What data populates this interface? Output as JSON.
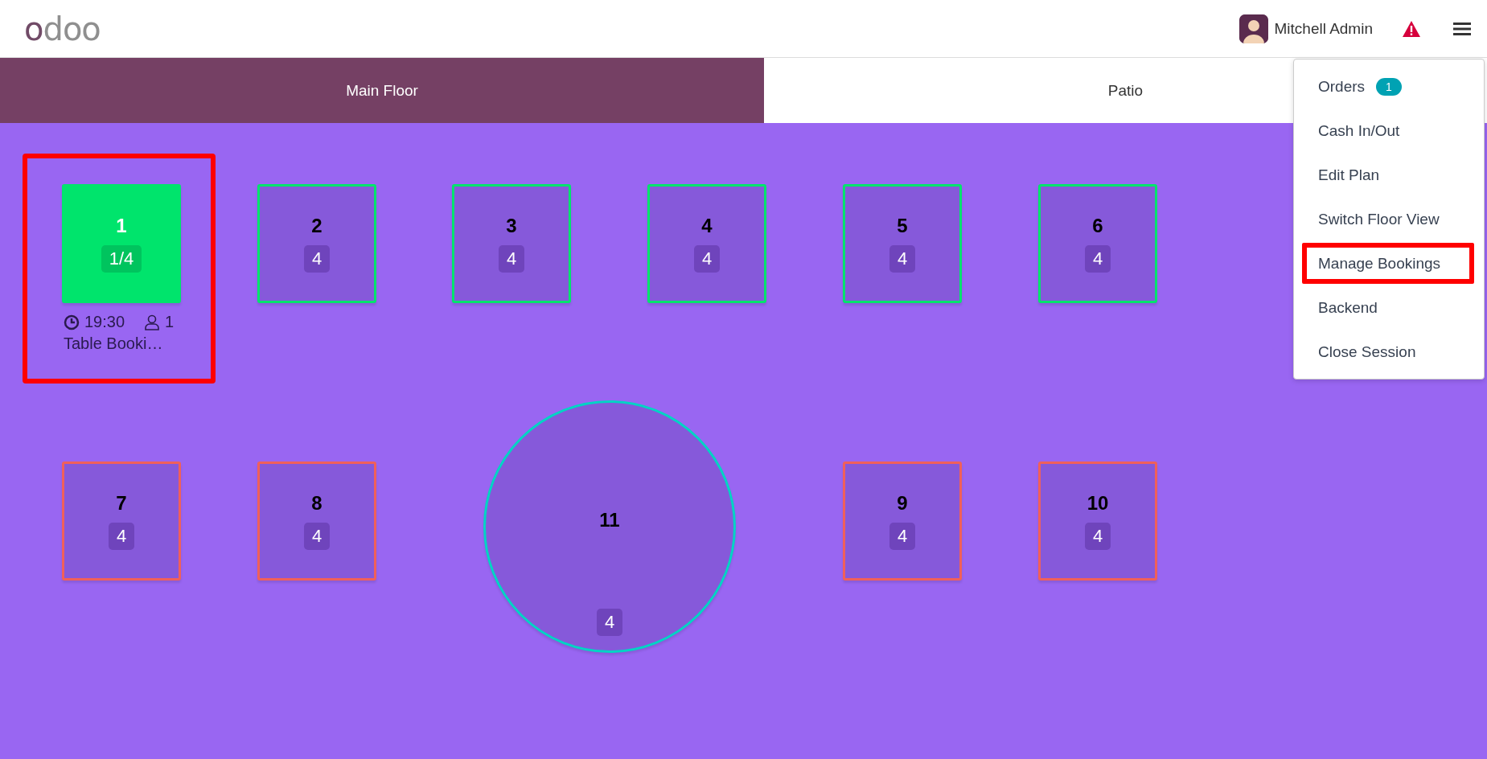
{
  "header": {
    "logo": "odoo",
    "user": "Mitchell Admin"
  },
  "floors": [
    {
      "label": "Main Floor",
      "selected": true
    },
    {
      "label": "Patio",
      "selected": false
    }
  ],
  "tables": [
    {
      "number": "1",
      "seats": "1/4",
      "kind": "square",
      "occupied": true,
      "color": "#00e46c",
      "highlighted": true,
      "booking": {
        "time": "19:30",
        "guests": "1",
        "name": "Table Booki…"
      }
    },
    {
      "number": "2",
      "seats": "4",
      "kind": "square",
      "occupied": false,
      "color": "#00e46c",
      "highlighted": false
    },
    {
      "number": "3",
      "seats": "4",
      "kind": "square",
      "occupied": false,
      "color": "#00e46c",
      "highlighted": false
    },
    {
      "number": "4",
      "seats": "4",
      "kind": "square",
      "occupied": false,
      "color": "#00e46c",
      "highlighted": false
    },
    {
      "number": "5",
      "seats": "4",
      "kind": "square",
      "occupied": false,
      "color": "#00e46c",
      "highlighted": false
    },
    {
      "number": "6",
      "seats": "4",
      "kind": "square",
      "occupied": false,
      "color": "#00e46c",
      "highlighted": false
    },
    {
      "number": "7",
      "seats": "4",
      "kind": "square",
      "occupied": false,
      "color": "#f0605a",
      "highlighted": false
    },
    {
      "number": "8",
      "seats": "4",
      "kind": "square",
      "occupied": false,
      "color": "#f0605a",
      "highlighted": false
    },
    {
      "number": "11",
      "seats": "4",
      "kind": "round",
      "occupied": false,
      "color": "#00d4c4",
      "highlighted": false
    },
    {
      "number": "9",
      "seats": "4",
      "kind": "square",
      "occupied": false,
      "color": "#f0605a",
      "highlighted": false
    },
    {
      "number": "10",
      "seats": "4",
      "kind": "square",
      "occupied": false,
      "color": "#f0605a",
      "highlighted": false
    }
  ],
  "menu": [
    {
      "label": "Orders",
      "badge": "1",
      "highlighted": false
    },
    {
      "label": "Cash In/Out",
      "highlighted": false
    },
    {
      "label": "Edit Plan",
      "highlighted": false
    },
    {
      "label": "Switch Floor View",
      "highlighted": false
    },
    {
      "label": "Manage Bookings",
      "highlighted": true
    },
    {
      "label": "Backend",
      "highlighted": false
    },
    {
      "label": "Close Session",
      "highlighted": false
    }
  ]
}
